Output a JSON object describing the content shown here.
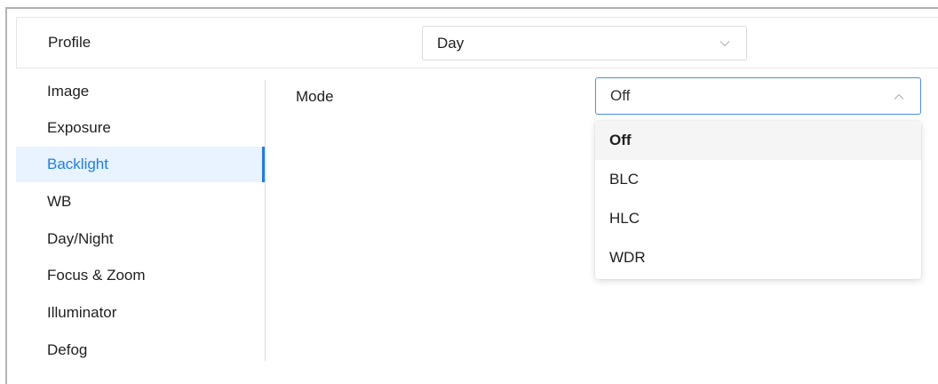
{
  "profile": {
    "label": "Profile",
    "value": "Day",
    "chevron_icon": "chevron-down-icon"
  },
  "sidebar": {
    "active_color": "#1e7ee8",
    "active_background": "#e8f3ff",
    "items": [
      {
        "label": "Image",
        "active": false
      },
      {
        "label": "Exposure",
        "active": false
      },
      {
        "label": "Backlight",
        "active": true
      },
      {
        "label": "WB",
        "active": false
      },
      {
        "label": "Day/Night",
        "active": false
      },
      {
        "label": "Focus & Zoom",
        "active": false
      },
      {
        "label": "Illuminator",
        "active": false
      },
      {
        "label": "Defog",
        "active": false
      }
    ]
  },
  "mode": {
    "label": "Mode",
    "value": "Off",
    "chevron_icon": "chevron-up-icon",
    "open": true,
    "options": [
      {
        "label": "Off",
        "selected": true
      },
      {
        "label": "BLC",
        "selected": false
      },
      {
        "label": "HLC",
        "selected": false
      },
      {
        "label": "WDR",
        "selected": false
      }
    ]
  }
}
